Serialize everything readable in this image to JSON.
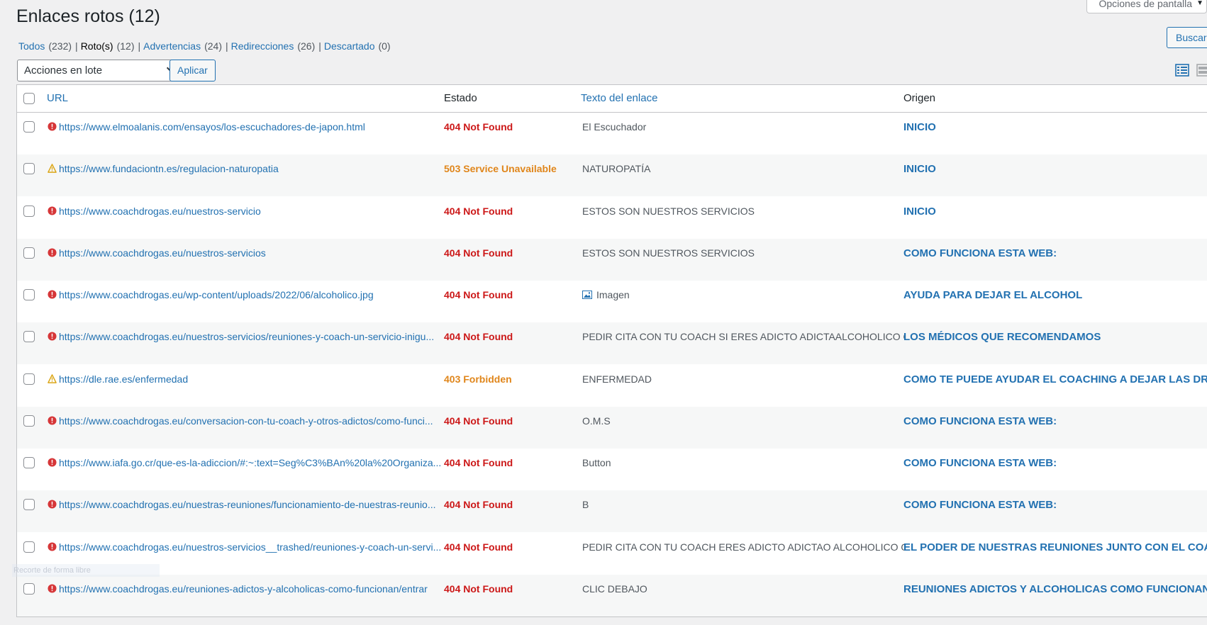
{
  "screen_options": "Opciones de pantalla",
  "title": "Enlaces rotos (12)",
  "search_button": "Buscar »",
  "filters": [
    {
      "label": "Todos",
      "count": "(232)",
      "current": false
    },
    {
      "label": "Roto(s)",
      "count": "(12)",
      "current": true
    },
    {
      "label": "Advertencias",
      "count": "(24)",
      "current": false
    },
    {
      "label": "Redirecciones",
      "count": "(26)",
      "current": false
    },
    {
      "label": "Descartado",
      "count": "(0)",
      "current": false
    }
  ],
  "bulk_actions": {
    "selected": "Acciones en lote",
    "apply": "Aplicar"
  },
  "columns": {
    "url": "URL",
    "status": "Estado",
    "text": "Texto del enlace",
    "origin": "Origen"
  },
  "colors": {
    "error": "#d63638",
    "warning": "#dba617",
    "link": "#2271b1",
    "status_error": "#cc1818",
    "status_warning": "#e0861b"
  },
  "rows": [
    {
      "icon": "error-icon",
      "url": "https://www.elmoalanis.com/ensayos/los-escuchadores-de-japon.html",
      "status": "404 Not Found",
      "level": "error",
      "text": "El Escuchador",
      "origin": "INICIO"
    },
    {
      "icon": "warning-icon",
      "url": "https://www.fundaciontn.es/regulacion-naturopatia",
      "status": "503 Service Unavailable",
      "level": "warning",
      "text": "NATUROPATÍA",
      "origin": "INICIO"
    },
    {
      "icon": "error-icon",
      "url": "https://www.coachdrogas.eu/nuestros-servicio",
      "status": "404 Not Found",
      "level": "error",
      "text": "ESTOS SON NUESTROS SERVICIOS",
      "origin": "INICIO"
    },
    {
      "icon": "error-icon",
      "url": "https://www.coachdrogas.eu/nuestros-servicios",
      "status": "404 Not Found",
      "level": "error",
      "text": "ESTOS SON NUESTROS SERVICIOS",
      "origin": "COMO FUNCIONA ESTA WEB:"
    },
    {
      "icon": "error-icon",
      "url": "https://www.coachdrogas.eu/wp-content/uploads/2022/06/alcoholico.jpg",
      "status": "404 Not Found",
      "level": "error",
      "text": "Imagen",
      "text_icon": "image-icon",
      "origin": "AYUDA PARA DEJAR EL ALCOHOL"
    },
    {
      "icon": "error-icon",
      "url": "https://www.coachdrogas.eu/nuestros-servicios/reuniones-y-coach-un-servicio-inigu...",
      "status": "404 Not Found",
      "level": "error",
      "text": "PEDIR CITA CON TU COACH SI ERES ADICTO ADICTAALCOHOLICO O A...",
      "origin": "LOS MÉDICOS QUE RECOMENDAMOS"
    },
    {
      "icon": "warning-icon",
      "url": "https://dle.rae.es/enfermedad",
      "status": "403 Forbidden",
      "level": "warning",
      "text": "ENFERMEDAD",
      "origin": "COMO TE PUEDE AYUDAR EL COACHING A DEJAR LAS DROGAS"
    },
    {
      "icon": "error-icon",
      "url": "https://www.coachdrogas.eu/conversacion-con-tu-coach-y-otros-adictos/como-funci...",
      "status": "404 Not Found",
      "level": "error",
      "text": "O.M.S",
      "origin": "COMO FUNCIONA ESTA WEB:"
    },
    {
      "icon": "error-icon",
      "url": "https://www.iafa.go.cr/que-es-la-adiccion/#:~:text=Seg%C3%BAn%20la%20Organiza...",
      "status": "404 Not Found",
      "level": "error",
      "text": "Button",
      "origin": "COMO FUNCIONA ESTA WEB:"
    },
    {
      "icon": "error-icon",
      "url": "https://www.coachdrogas.eu/nuestras-reuniones/funcionamiento-de-nuestras-reunio...",
      "status": "404 Not Found",
      "level": "error",
      "text": "B",
      "origin": "COMO FUNCIONA ESTA WEB:"
    },
    {
      "icon": "error-icon",
      "url": "https://www.coachdrogas.eu/nuestros-servicios__trashed/reuniones-y-coach-un-servi...",
      "status": "404 Not Found",
      "level": "error",
      "text": "PEDIR CITA CON TU COACH ERES ADICTO ADICTAO ALCOHOLICO O A...",
      "origin": "EL PODER DE NUESTRAS REUNIONES JUNTO CON EL COACHING"
    },
    {
      "icon": "error-icon",
      "url": "https://www.coachdrogas.eu/reuniones-adictos-y-alcoholicas-como-funcionan/entrar",
      "status": "404 Not Found",
      "level": "error",
      "text": "CLIC DEBAJO",
      "origin": "REUNIONES ADICTOS Y ALCOHOLICAS COMO FUNCIONAN"
    }
  ],
  "overlay_text": "Recorte de forma libre"
}
